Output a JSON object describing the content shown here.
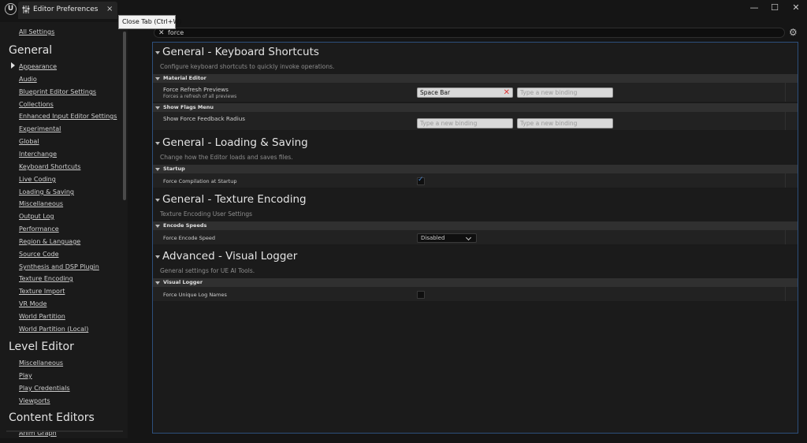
{
  "window": {
    "tab_label": "Editor Preferences",
    "tab_close_glyph": "×",
    "tooltip": "Close Tab (Ctrl+W)",
    "logo_glyph": "U",
    "minimize_glyph": "—",
    "maximize_glyph": "☐",
    "close_glyph": "✕"
  },
  "search": {
    "value": "force",
    "clear_glyph": "✕",
    "settings_glyph": "⚙"
  },
  "sidebar": {
    "all_settings": "All Settings",
    "groups": [
      {
        "title": "General",
        "items": [
          "Appearance",
          "Audio",
          "Blueprint Editor Settings",
          "Collections",
          "Enhanced Input Editor Settings",
          "Experimental",
          "Global",
          "Interchange",
          "Keyboard Shortcuts",
          "Live Coding",
          "Loading & Saving",
          "Miscellaneous",
          "Output Log",
          "Performance",
          "Region & Language",
          "Source Code",
          "Synthesis and DSP Plugin",
          "Texture Encoding",
          "Texture Import",
          "VR Mode",
          "World Partition",
          "World Partition (Local)"
        ]
      },
      {
        "title": "Level Editor",
        "items": [
          "Miscellaneous",
          "Play",
          "Play Credentials",
          "Viewports"
        ]
      },
      {
        "title": "Content Editors",
        "items": [
          "Anim Graph"
        ]
      }
    ]
  },
  "sections": [
    {
      "title": "General - Keyboard Shortcuts",
      "description": "Configure keyboard shortcuts to quickly invoke operations.",
      "categories": [
        {
          "label": "Material Editor",
          "rows": [
            {
              "name": "Force Refresh Previews",
              "subtext": "Forces a refresh of all previews",
              "binding1": "Space Bar",
              "binding2_placeholder": "Type a new binding"
            }
          ]
        },
        {
          "label": "Show Flags Menu",
          "rows": [
            {
              "name": "Show Force Feedback Radius",
              "binding1_placeholder": "Type a new binding",
              "binding2_placeholder": "Type a new binding"
            }
          ]
        }
      ]
    },
    {
      "title": "General - Loading & Saving",
      "description": "Change how the Editor loads and saves files.",
      "categories": [
        {
          "label": "Startup",
          "rows": [
            {
              "name": "Force Compilation at Startup",
              "checked": true
            }
          ]
        }
      ]
    },
    {
      "title": "General - Texture Encoding",
      "description": "Texture Encoding User Settings",
      "categories": [
        {
          "label": "Encode Speeds",
          "rows": [
            {
              "name": "Force Encode Speed",
              "value": "Disabled"
            }
          ]
        }
      ]
    },
    {
      "title": "Advanced - Visual Logger",
      "description": "General settings for UE AI Tools.",
      "categories": [
        {
          "label": "Visual Logger",
          "rows": [
            {
              "name": "Force Unique Log Names",
              "checked": false
            }
          ]
        }
      ]
    }
  ],
  "colors": {
    "accent": "#4c8bd8",
    "panel_border": "#2d4f7c",
    "clear_red": "#dd3333"
  }
}
